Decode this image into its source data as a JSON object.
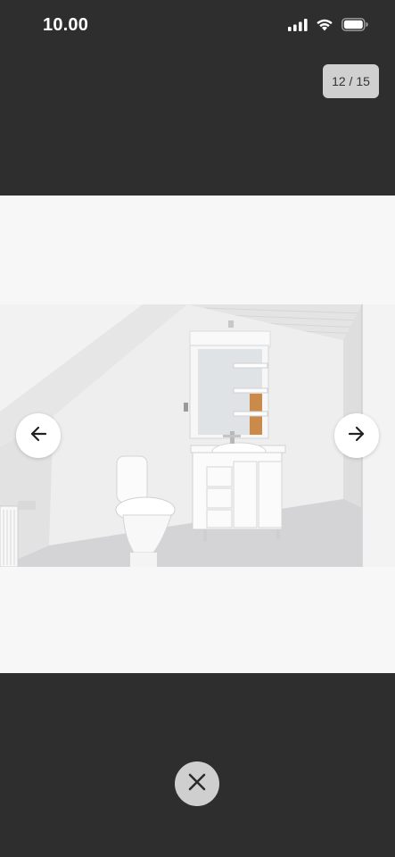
{
  "status_bar": {
    "time": "10.00",
    "icons": [
      "signal-icon",
      "wifi-icon",
      "battery-icon"
    ]
  },
  "gallery": {
    "counter": "12 / 15",
    "current_index": 12,
    "total": 15
  },
  "photo": {
    "description_icon": "bathroom-photo"
  },
  "controls": {
    "prev_icon": "arrow-left-icon",
    "next_icon": "arrow-right-icon",
    "close_icon": "close-icon"
  },
  "colors": {
    "background": "#2e2e2e",
    "viewer_background": "#f7f7f7",
    "badge_background": "#d0d0d0",
    "close_button_background": "#cfcfcf"
  }
}
